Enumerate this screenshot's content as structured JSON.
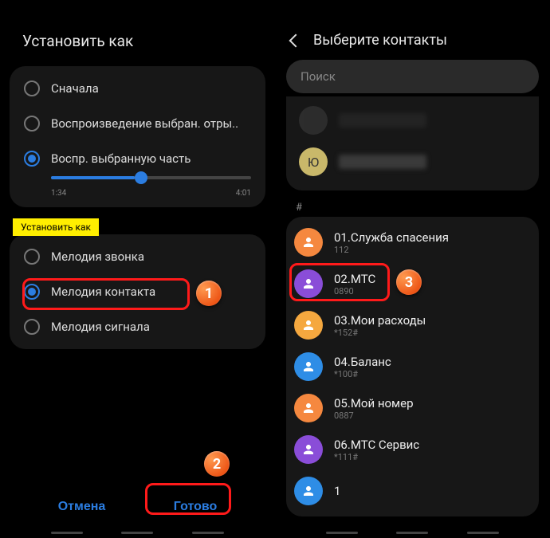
{
  "left": {
    "title": "Установить как",
    "play_options": [
      {
        "label": "Сначала",
        "checked": false
      },
      {
        "label": "Воспроизведение выбран. отры..",
        "checked": false
      },
      {
        "label": "Воспр. выбранную часть",
        "checked": true
      }
    ],
    "time_start": "1:34",
    "time_end": "4:01",
    "tag": "Установить как",
    "set_options": [
      {
        "label": "Мелодия звонка",
        "checked": false
      },
      {
        "label": "Мелодия контакта",
        "checked": true
      },
      {
        "label": "Мелодия сигнала",
        "checked": false
      }
    ],
    "cancel": "Отмена",
    "done": "Готово"
  },
  "right": {
    "title": "Выберите контакты",
    "search_placeholder": "Поиск",
    "recent_avatar_letter": "Ю",
    "section_letter": "#",
    "contacts": [
      {
        "name": "01.Служба спасения",
        "sub": "112",
        "color": "#f5883f"
      },
      {
        "name": "02.МТС",
        "sub": "0890",
        "color": "#8a4dd8"
      },
      {
        "name": "03.Мои расходы",
        "sub": "*152#",
        "color": "#f5a83f"
      },
      {
        "name": "04.Баланс",
        "sub": "*100#",
        "color": "#2e8de6"
      },
      {
        "name": "05.Мой номер",
        "sub": "0887",
        "color": "#f5883f"
      },
      {
        "name": "06.МТС Сервис",
        "sub": "*111#",
        "color": "#8a4dd8"
      },
      {
        "name": "1",
        "sub": "",
        "color": "#2e8de6"
      }
    ]
  },
  "steps": {
    "s1": "1",
    "s2": "2",
    "s3": "3"
  }
}
